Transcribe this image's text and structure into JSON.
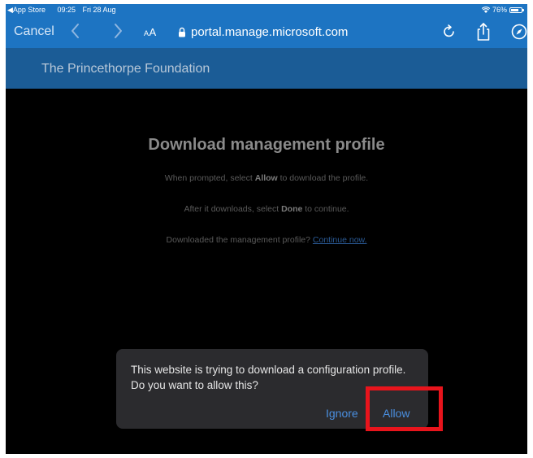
{
  "status_bar": {
    "back_app": "App Store",
    "time": "09:25",
    "date": "Fri 28 Aug",
    "battery": "76%",
    "battery_level": 0.76
  },
  "browser": {
    "cancel_label": "Cancel",
    "text_size_label_small": "A",
    "text_size_label_large": "A",
    "url": "portal.manage.microsoft.com",
    "icons": [
      "chevron-left-icon",
      "chevron-right-icon",
      "lock-icon",
      "reload-icon",
      "share-icon",
      "compass-icon"
    ]
  },
  "page": {
    "org_name": "The Princethorpe Foundation",
    "heading": "Download management profile",
    "line1_pre": "When prompted, select ",
    "line1_bold": "Allow",
    "line1_post": " to download the profile.",
    "line2_pre": "After it downloads, select ",
    "line2_bold": "Done",
    "line2_post": " to continue.",
    "line3_pre": "Downloaded the management profile? ",
    "line3_link": "Continue now."
  },
  "dialog": {
    "message": "This website is trying to download a configuration profile. Do you want to allow this?",
    "ignore_label": "Ignore",
    "allow_label": "Allow"
  },
  "colors": {
    "chrome_blue": "#1d74c2",
    "banner_blue": "#1b5c96",
    "highlight_red": "#e8141c",
    "button_blue": "#4a8fe0"
  }
}
